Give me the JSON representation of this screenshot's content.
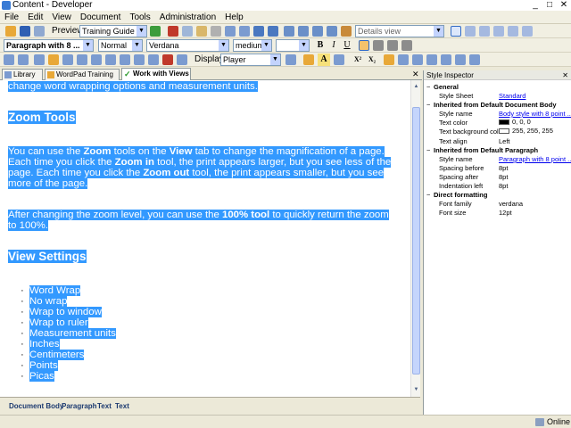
{
  "window": {
    "title": "Content - Developer",
    "minimize": "_",
    "maximize": "□",
    "close": "✕"
  },
  "menu": [
    "File",
    "Edit",
    "View",
    "Document",
    "Tools",
    "Administration",
    "Help"
  ],
  "toolbar1": {
    "preview_label": "Preview:",
    "preview_value": "Training Guide",
    "view_value": "Details view"
  },
  "toolbar2": {
    "style_value": "Paragraph with 8 ...",
    "normal_value": "Normal",
    "font_value": "Verdana",
    "size_value": "medium",
    "bold": "B",
    "italic": "I",
    "underline": "U"
  },
  "toolbar3": {
    "display_label": "Display:",
    "display_value": "Player",
    "sup": "X²",
    "sub": "X₂"
  },
  "tabs": [
    {
      "label": "Library"
    },
    {
      "label": "WordPad Training"
    },
    {
      "label": "Work with Views"
    }
  ],
  "document": {
    "line0": "change word wrapping options and measurement units.",
    "h_zoom": "Zoom Tools",
    "zoom_lines": [
      [
        "You can use the ",
        "Zoom",
        " tools on the ",
        "View",
        " tab to change the magnification of a page."
      ],
      [
        "Each time you click the ",
        "Zoom in",
        " tool, the print appears larger, but you see less of the"
      ],
      [
        "page. Each time you click the ",
        "Zoom out",
        " tool, the print appears smaller, but you see"
      ],
      [
        "more of the page.",
        "",
        "",
        "",
        ""
      ]
    ],
    "after_lines": [
      [
        "After changing the zoom level, you can use the ",
        "100% tool",
        " to quickly return the zoom"
      ],
      [
        "to 100%.",
        "",
        ""
      ]
    ],
    "h_view": "View Settings",
    "list": [
      "Word Wrap",
      "No wrap",
      "Wrap to window",
      "Wrap to ruler",
      "Measurement units",
      "Inches",
      "Centimeters",
      "Points",
      "Picas"
    ],
    "bullet": "·"
  },
  "path": [
    "Document Body",
    "Paragraph",
    "Text",
    "Text"
  ],
  "inspector": {
    "title": "Style Inspector",
    "sections": [
      {
        "name": "General",
        "toggle": "−",
        "props": [
          {
            "name": "Style Sheet",
            "value": "Standard",
            "link": true
          }
        ]
      },
      {
        "name": "Inherited from Default Document Body",
        "toggle": "−",
        "props": [
          {
            "name": "Style name",
            "value": "Body style with 8 point ...",
            "link": true
          },
          {
            "name": "Text color",
            "value": "0, 0, 0",
            "swatch": "#000000"
          },
          {
            "name": "Text background color",
            "value": "255, 255, 255",
            "swatch": "#ffffff"
          },
          {
            "name": "Text align",
            "value": "Left"
          }
        ]
      },
      {
        "name": "Inherited from Default Paragraph",
        "toggle": "−",
        "props": [
          {
            "name": "Style name",
            "value": "Paragraph with 8 point ...",
            "link": true
          },
          {
            "name": "Spacing before",
            "value": "8pt"
          },
          {
            "name": "Spacing after",
            "value": "8pt"
          },
          {
            "name": "Indentation left",
            "value": "8pt"
          }
        ]
      },
      {
        "name": "Direct formatting",
        "toggle": "−",
        "props": [
          {
            "name": "Font family",
            "value": "verdana"
          },
          {
            "name": "Font size",
            "value": "12pt"
          }
        ]
      }
    ]
  },
  "status": {
    "online": "Online"
  },
  "colors": {
    "selection": "#3399ff",
    "link": "#0000ee",
    "chrome": "#ece9d8"
  }
}
